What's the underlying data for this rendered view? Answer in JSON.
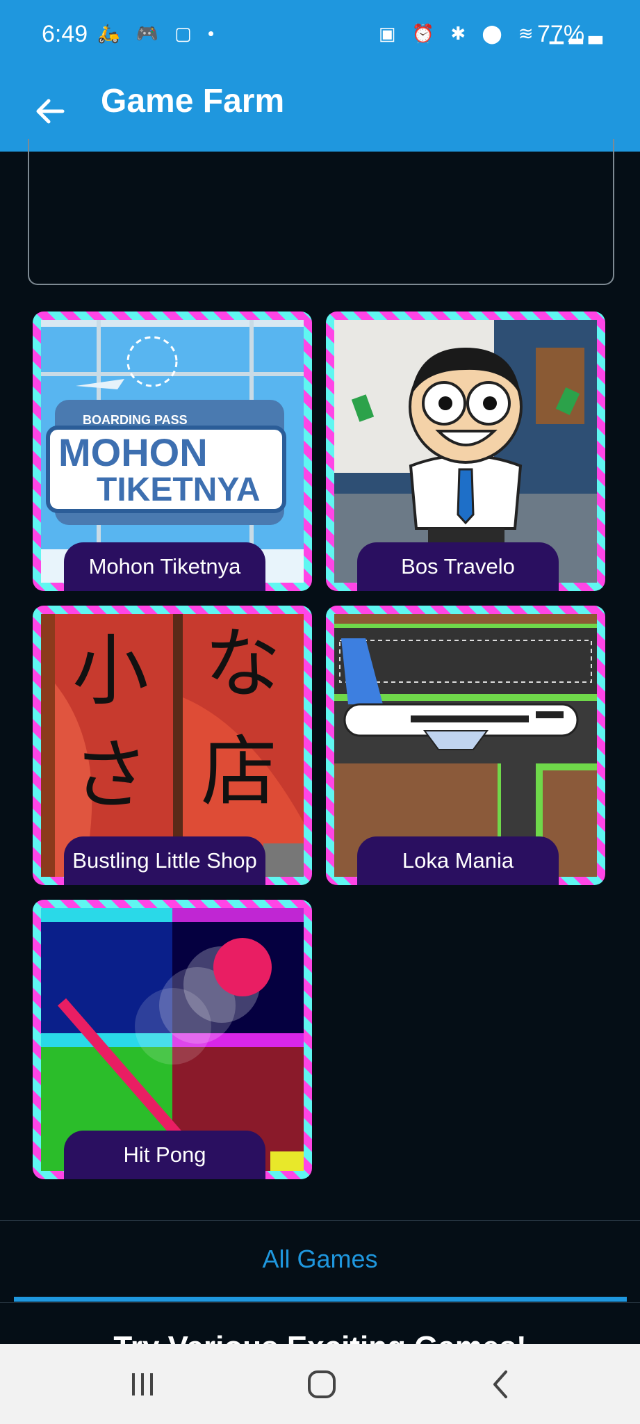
{
  "status_bar": {
    "time": "6:49",
    "left_icons": [
      "delivery-icon",
      "game-controller-icon",
      "instagram-icon",
      "dot-icon"
    ],
    "right_icons": [
      "battery-saver-icon",
      "alarm-icon",
      "bluetooth-icon",
      "location-icon",
      "wifi-icon",
      "signal-icon"
    ],
    "battery_text": "77%"
  },
  "app_bar": {
    "title": "Game Farm",
    "back_icon": "arrow-left-icon",
    "background": "#1f97de"
  },
  "games": [
    {
      "name": "Mohon Tiketnya",
      "art_text": [
        "BOARDING PASS",
        "MOHON",
        "TIKETNYA"
      ]
    },
    {
      "name": "Bos Travelo"
    },
    {
      "name": "Bustling Little Shop",
      "art_text": [
        "小",
        "な",
        "さ",
        "店"
      ]
    },
    {
      "name": "Loka Mania"
    },
    {
      "name": "Hit Pong"
    }
  ],
  "tabs": {
    "active_label": "All Games",
    "accent": "#1f97de"
  },
  "section_heading": "Try Various Exciting Games!",
  "nav_bar": {
    "icons": [
      "recent-apps-icon",
      "home-icon",
      "back-icon"
    ]
  }
}
